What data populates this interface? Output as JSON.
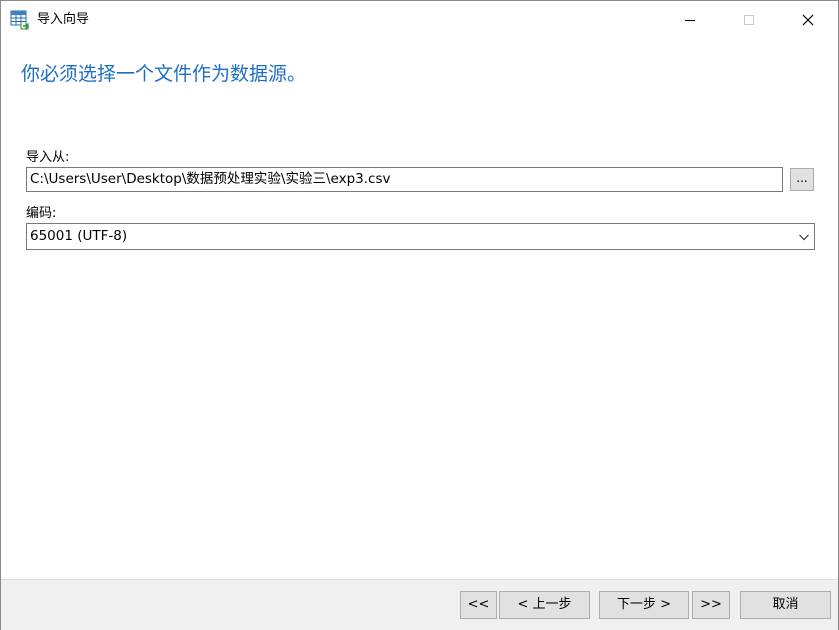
{
  "window": {
    "title": "导入向导",
    "icon": "table-import-icon",
    "controls": {
      "minimize": "minimize-icon",
      "maximize": "maximize-icon",
      "close": "close-icon"
    }
  },
  "heading": "你必须选择一个文件作为数据源。",
  "form": {
    "import_from_label": "导入从:",
    "import_from_value": "C:\\Users\\User\\Desktop\\数据预处理实验\\实验三\\exp3.csv",
    "browse_label": "...",
    "encoding_label": "编码:",
    "encoding_value": "65001 (UTF-8)"
  },
  "footer": {
    "first_label": "<<",
    "prev_label": "< 上一步",
    "next_label": "下一步 >",
    "last_label": ">>",
    "cancel_label": "取消"
  },
  "colors": {
    "heading": "#1e6fc4",
    "footer_bg": "#f0f0f0",
    "button_bg": "#e1e1e1"
  }
}
